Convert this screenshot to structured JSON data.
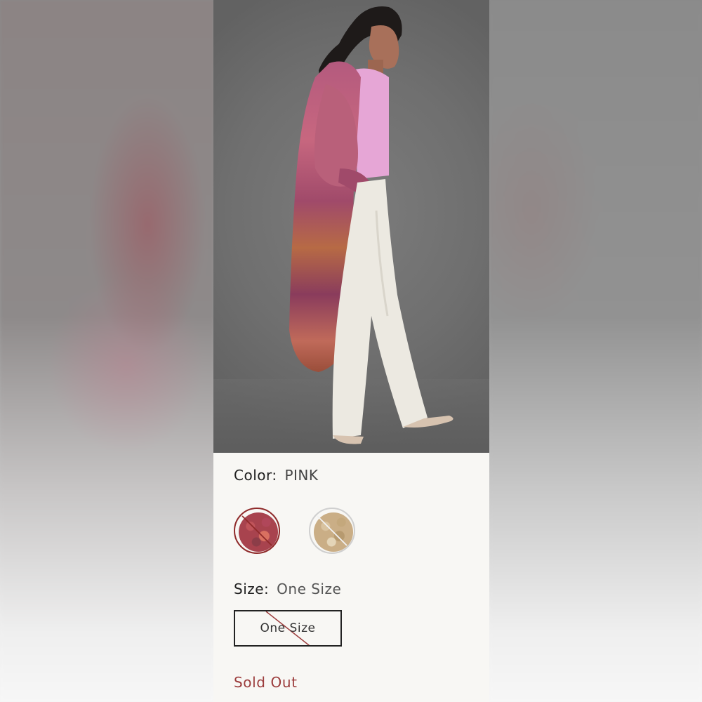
{
  "product": {
    "color_label": "Color:",
    "color_value": "PINK",
    "size_label": "Size:",
    "size_value": "One Size",
    "size_option": "One Size",
    "status": "Sold Out"
  },
  "swatches": [
    {
      "name": "pink-swatch",
      "selected": true,
      "unavailable": true
    },
    {
      "name": "beige-swatch",
      "selected": false,
      "unavailable": true
    }
  ],
  "colors": {
    "status_red": "#9b3b3b",
    "selected_ring": "#8f2a2a",
    "card_background": "#f8f7f4"
  }
}
